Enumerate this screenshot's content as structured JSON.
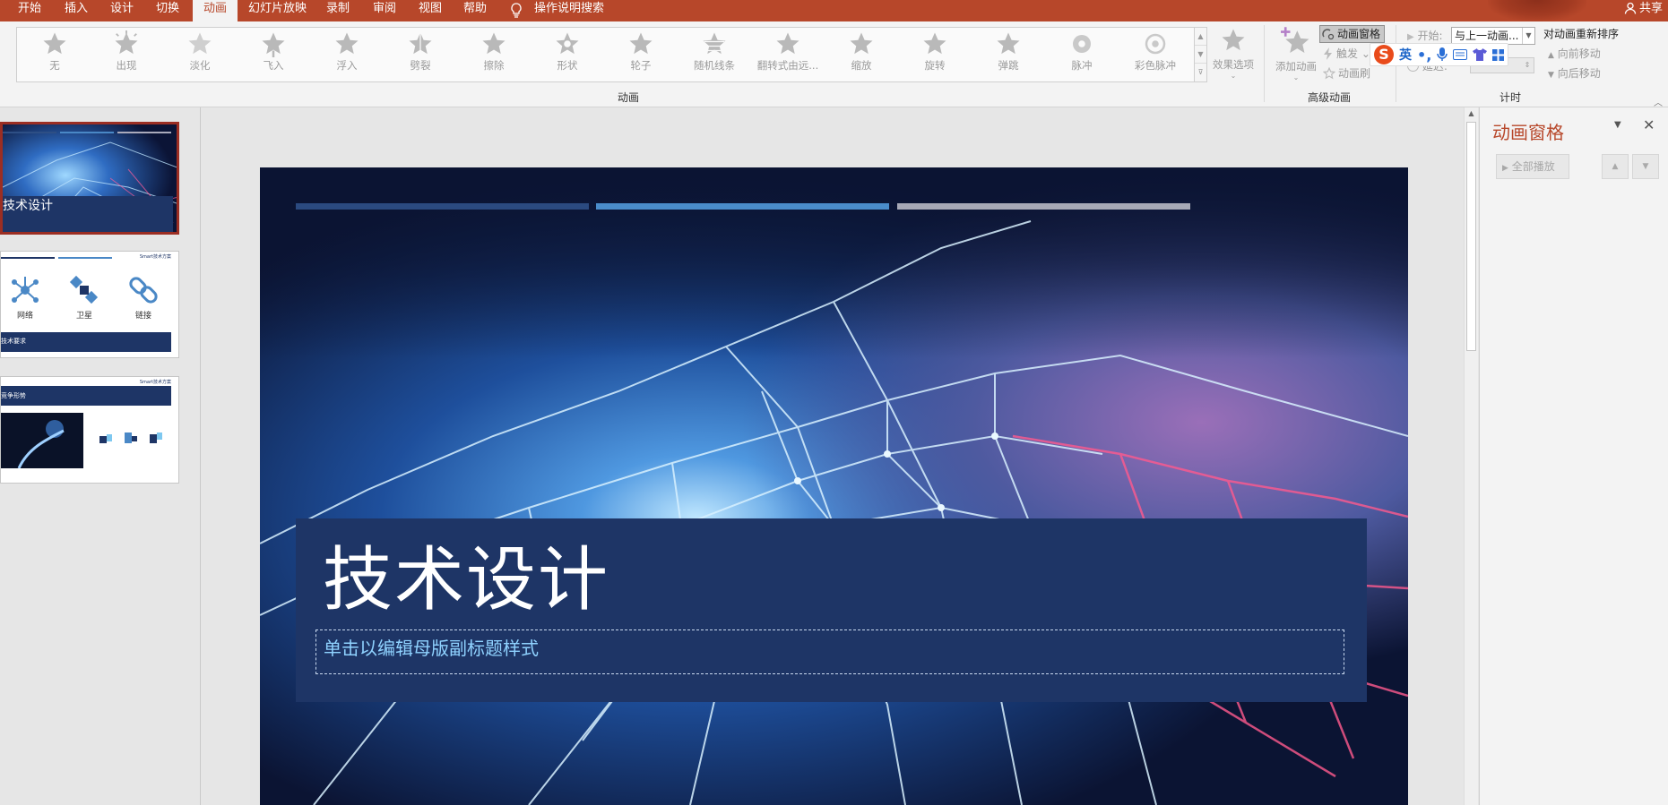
{
  "tabs": [
    {
      "label": "开始",
      "active": false
    },
    {
      "label": "插入",
      "active": false
    },
    {
      "label": "设计",
      "active": false
    },
    {
      "label": "切换",
      "active": false
    },
    {
      "label": "动画",
      "active": true
    },
    {
      "label": "幻灯片放映",
      "active": false
    },
    {
      "label": "录制",
      "active": false
    },
    {
      "label": "审阅",
      "active": false
    },
    {
      "label": "视图",
      "active": false
    },
    {
      "label": "帮助",
      "active": false
    }
  ],
  "tell_me": "操作说明搜索",
  "share": "共享",
  "effects": [
    "无",
    "出现",
    "淡化",
    "飞入",
    "浮入",
    "劈裂",
    "擦除",
    "形状",
    "轮子",
    "随机线条",
    "翻转式由远...",
    "缩放",
    "旋转",
    "弹跳",
    "脉冲",
    "彩色脉冲"
  ],
  "effect_options": "效果选项",
  "group_animation": "动画",
  "add_animation": "添加动画",
  "anim_pane_btn": "动画窗格",
  "trigger": "触发",
  "anim_painter": "动画刷",
  "group_advanced": "高级动画",
  "start_label": "开始:",
  "start_value": "与上一动画...",
  "duration_label": "持续时间:",
  "delay_label": "延迟:",
  "group_timing": "计时",
  "reorder_title": "对动画重新排序",
  "move_earlier": "向前移动",
  "move_later": "向后移动",
  "ime": {
    "logo": "S",
    "mode": "英"
  },
  "thumbnails": {
    "slide1_title": "技术设计",
    "slide2_header": "Smart技术方案",
    "slide2_items": [
      "网络",
      "卫星",
      "链接"
    ],
    "slide2_footer": "技术要求",
    "slide3_header": "Smart技术方案",
    "slide3_title": "竞争形势"
  },
  "slide": {
    "title": "技术设计",
    "subtitle": "单击以编辑母版副标题样式"
  },
  "animation_pane": {
    "title": "动画窗格",
    "play_all": "全部播放"
  },
  "colors": {
    "accent": "#b7472a",
    "slide_panel": "#1e3566",
    "subtitle": "#8fd2ff"
  }
}
